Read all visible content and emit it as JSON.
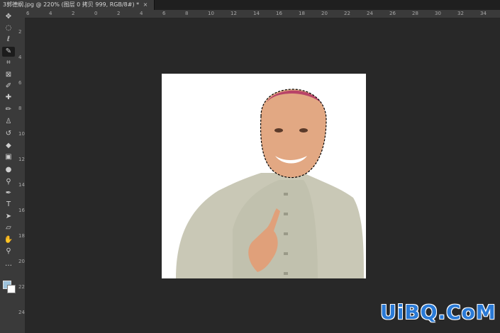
{
  "document_tab": {
    "title": "3郭德纲.jpg @ 220% (图层 0 拷贝 999, RGB/8#) *",
    "close_glyph": "×"
  },
  "ruler": {
    "h_labels": [
      "6",
      "4",
      "2",
      "0",
      "2",
      "4",
      "6",
      "8",
      "10",
      "12",
      "14",
      "16",
      "18",
      "20",
      "22",
      "24",
      "26",
      "28",
      "30",
      "32",
      "34"
    ],
    "v_labels": [
      "2",
      "4",
      "6",
      "8",
      "10",
      "12",
      "14",
      "16",
      "18",
      "20",
      "22",
      "24"
    ]
  },
  "tools": [
    {
      "name": "move-tool",
      "glyph": "✥"
    },
    {
      "name": "marquee-tool",
      "glyph": "◌"
    },
    {
      "name": "lasso-tool",
      "glyph": "ℓ"
    },
    {
      "name": "quick-selection-tool",
      "glyph": "✎"
    },
    {
      "name": "crop-tool",
      "glyph": "⌗"
    },
    {
      "name": "frame-tool",
      "glyph": "⊠"
    },
    {
      "name": "eyedropper-tool",
      "glyph": "✐"
    },
    {
      "name": "healing-brush-tool",
      "glyph": "✚"
    },
    {
      "name": "brush-tool",
      "glyph": "✏"
    },
    {
      "name": "clone-stamp-tool",
      "glyph": "♙"
    },
    {
      "name": "history-brush-tool",
      "glyph": "↺"
    },
    {
      "name": "eraser-tool",
      "glyph": "◆"
    },
    {
      "name": "gradient-tool",
      "glyph": "▣"
    },
    {
      "name": "blur-tool",
      "glyph": "●"
    },
    {
      "name": "dodge-tool",
      "glyph": "⚲"
    },
    {
      "name": "pen-tool",
      "glyph": "✒"
    },
    {
      "name": "type-tool",
      "glyph": "T"
    },
    {
      "name": "path-selection-tool",
      "glyph": "➤"
    },
    {
      "name": "shape-tool",
      "glyph": "▱"
    },
    {
      "name": "hand-tool",
      "glyph": "✋"
    },
    {
      "name": "zoom-tool",
      "glyph": "⚲"
    },
    {
      "name": "more-tools",
      "glyph": "…"
    }
  ],
  "colors": {
    "foreground": "#9ec3dc",
    "background": "#ffffff",
    "accent_watermark": "#2a7ad6"
  },
  "watermark": {
    "text": "UiBQ.CoM"
  }
}
